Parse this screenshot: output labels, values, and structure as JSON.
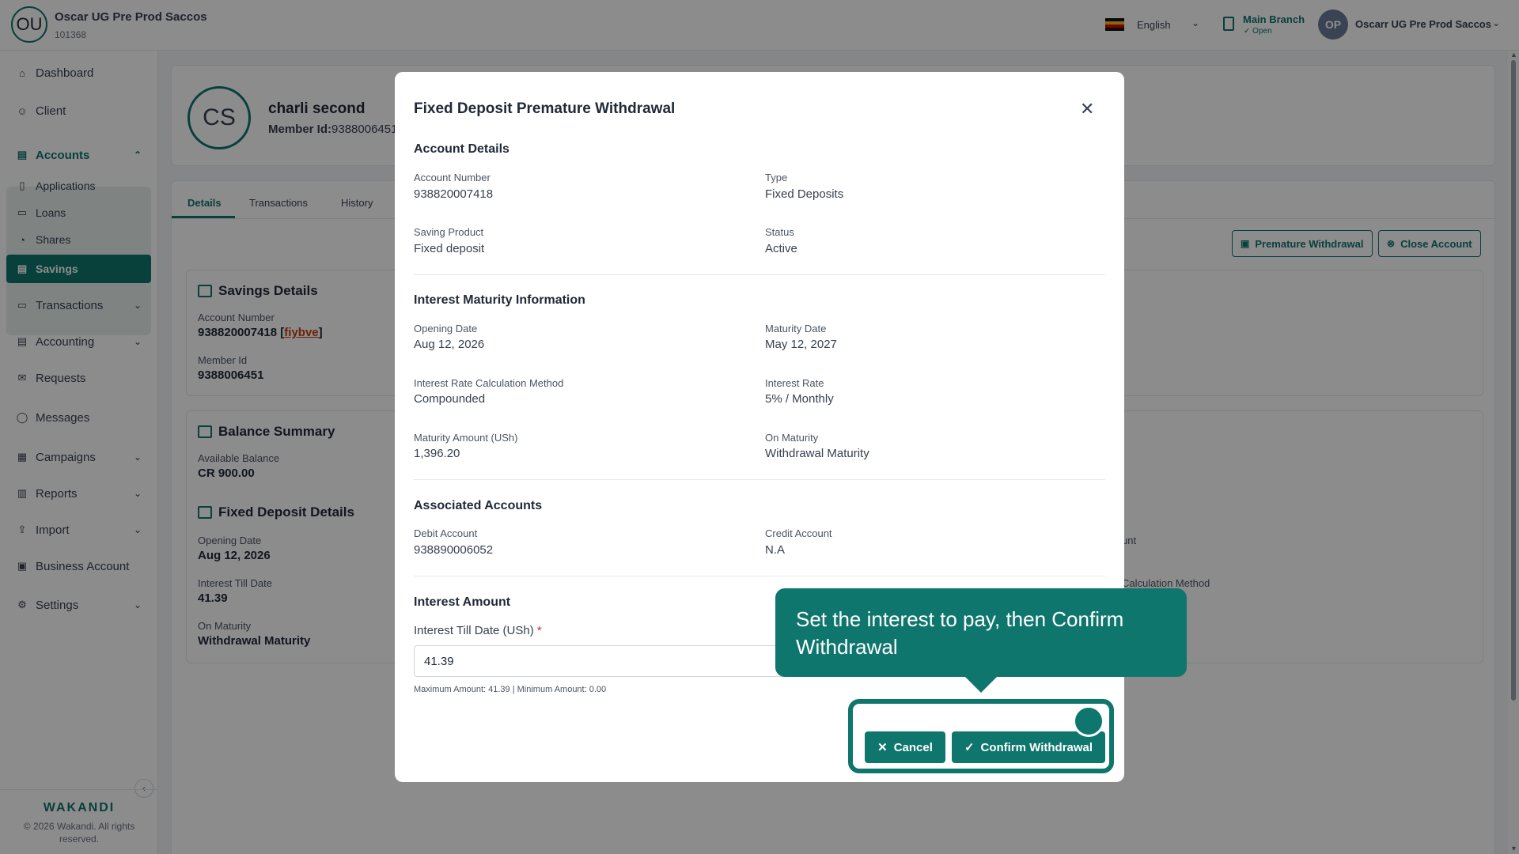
{
  "header": {
    "org_initials": "OU",
    "org_name": "Oscar UG Pre Prod Saccos",
    "org_code": "101368",
    "language": "English",
    "branch_name": "Main Branch",
    "branch_status": "Open",
    "user_initials": "OP",
    "user_name": "Oscarr UG Pre Prod Saccos"
  },
  "sidebar": {
    "dashboard": "Dashboard",
    "client": "Client",
    "accounts": "Accounts",
    "applications": "Applications",
    "loans": "Loans",
    "shares": "Shares",
    "savings": "Savings",
    "transactions": "Transactions",
    "accounting": "Accounting",
    "requests": "Requests",
    "messages": "Messages",
    "campaigns": "Campaigns",
    "reports": "Reports",
    "import": "Import",
    "business_account": "Business Account",
    "settings": "Settings",
    "brand": "WAKANDI",
    "copyright": "© 2026 Wakandi. All rights reserved."
  },
  "profile": {
    "initials": "CS",
    "name": "charli second",
    "member_id_label": "Member Id:",
    "member_id": "9388006451"
  },
  "tabs": [
    "Details",
    "Transactions",
    "History"
  ],
  "actions": {
    "premature_withdrawal": "Premature Withdrawal",
    "close_account": "Close Account"
  },
  "savings_details": {
    "title": "Savings Details",
    "account_number_label": "Account Number",
    "account_number": "938820007418",
    "account_tag": "fiybve",
    "member_id_label": "Member Id",
    "member_id": "9388006451"
  },
  "balance_summary": {
    "title": "Balance Summary",
    "available_label": "Available Balance",
    "available": "CR 900.00"
  },
  "fd_details": {
    "title": "Fixed Deposit Details",
    "opening_label": "Opening Date",
    "opening": "Aug 12, 2026",
    "interest_till_label": "Interest Till Date",
    "interest_till": "41.39",
    "on_maturity_label": "On Maturity",
    "on_maturity": "Withdrawal Maturity",
    "partial_right_1": "unt",
    "partial_right_2": "Calculation Method"
  },
  "modal": {
    "title": "Fixed Deposit Premature Withdrawal",
    "account_details": {
      "title": "Account Details",
      "account_number_label": "Account Number",
      "account_number": "938820007418",
      "type_label": "Type",
      "type": "Fixed Deposits",
      "saving_product_label": "Saving Product",
      "saving_product": "Fixed deposit",
      "status_label": "Status",
      "status": "Active"
    },
    "interest_info": {
      "title": "Interest Maturity Information",
      "opening_label": "Opening Date",
      "opening": "Aug 12, 2026",
      "maturity_label": "Maturity Date",
      "maturity": "May 12, 2027",
      "calc_label": "Interest Rate Calculation Method",
      "calc": "Compounded",
      "rate_label": "Interest Rate",
      "rate": "5% / Monthly",
      "maturity_amount_label": "Maturity Amount (USh)",
      "maturity_amount": "1,396.20",
      "on_maturity_label": "On Maturity",
      "on_maturity": "Withdrawal Maturity"
    },
    "associated": {
      "title": "Associated Accounts",
      "debit_label": "Debit Account",
      "debit": "938890006052",
      "credit_label": "Credit Account",
      "credit": "N.A"
    },
    "interest_amount": {
      "title": "Interest Amount",
      "input_label": "Interest Till Date (USh)",
      "required": "*",
      "value": "41.39",
      "hint": "Maximum Amount: 41.39 | Minimum Amount: 0.00"
    },
    "cancel": "Cancel",
    "confirm": "Confirm Withdrawal"
  },
  "tour": {
    "message": "Set the interest to pay, then Confirm Withdrawal"
  },
  "colors": {
    "brand": "#0f766e",
    "link": "#c2410c"
  }
}
